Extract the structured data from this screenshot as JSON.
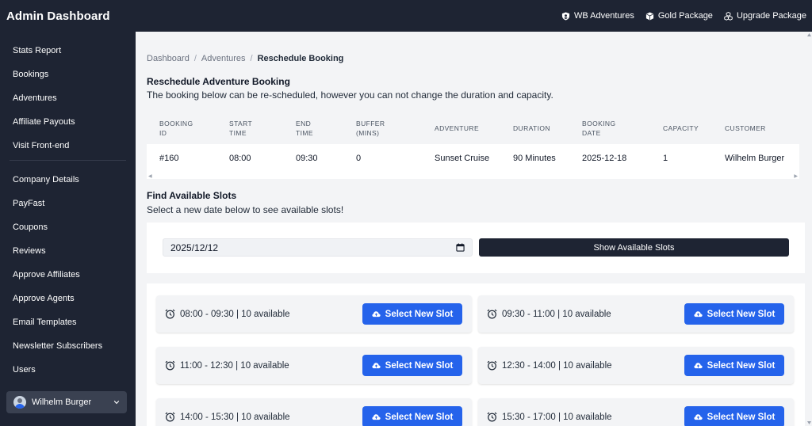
{
  "app": {
    "title": "Admin Dashboard",
    "topnav": [
      {
        "label": "WB Adventures",
        "icon": "shield-icon"
      },
      {
        "label": "Gold Package",
        "icon": "box-icon"
      },
      {
        "label": "Upgrade Package",
        "icon": "cubes-icon"
      }
    ]
  },
  "sidebar": {
    "group1": [
      "Stats Report",
      "Bookings",
      "Adventures",
      "Affiliate Payouts",
      "Visit Front-end"
    ],
    "group2": [
      "Company Details",
      "PayFast",
      "Coupons",
      "Reviews",
      "Approve Affiliates",
      "Approve Agents",
      "Email Templates",
      "Newsletter Subscribers",
      "Users"
    ],
    "user": "Wilhelm Burger"
  },
  "breadcrumb": {
    "items": [
      "Dashboard",
      "Adventures"
    ],
    "current": "Reschedule Booking"
  },
  "reschedule": {
    "title": "Reschedule Adventure Booking",
    "description": "The booking below can be re-scheduled, however you can not change the duration and capacity."
  },
  "table": {
    "headers": [
      [
        "BOOKING",
        "ID"
      ],
      [
        "START",
        "TIME"
      ],
      [
        "END",
        "TIME"
      ],
      [
        "BUFFER",
        "(MINS)"
      ],
      [
        "ADVENTURE",
        ""
      ],
      [
        "DURATION",
        ""
      ],
      [
        "BOOKING",
        "DATE"
      ],
      [
        "CAPACITY",
        ""
      ],
      [
        "CUSTOMER",
        ""
      ]
    ],
    "row": [
      "#160",
      "08:00",
      "09:30",
      "0",
      "Sunset Cruise",
      "90 Minutes",
      "2025-12-18",
      "1",
      "Wilhelm Burger"
    ]
  },
  "find": {
    "title": "Find Available Slots",
    "description": "Select a new date below to see available slots!",
    "date_value": "2025/12/12",
    "show_button": "Show Available Slots"
  },
  "slots": {
    "button_label": "Select New Slot",
    "items": [
      "08:00 - 09:30 | 10 available",
      "09:30 - 11:00 | 10 available",
      "11:00 - 12:30 | 10 available",
      "12:30 - 14:00 | 10 available",
      "14:00 - 15:30 | 10 available",
      "15:30 - 17:00 | 10 available"
    ]
  },
  "colors": {
    "sidebar": "#1e2433",
    "accent": "#2563eb",
    "background": "#f3f4f6"
  }
}
